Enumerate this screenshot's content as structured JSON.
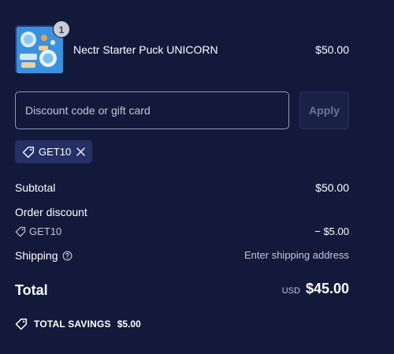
{
  "product": {
    "name": "Nectr Starter Puck UNICORN",
    "price": "$50.00",
    "quantity": "1",
    "thumbnail_icon": "product-image"
  },
  "discount": {
    "placeholder": "Discount code or gift card",
    "value": "",
    "apply_label": "Apply",
    "applied_code": "GET10"
  },
  "summary": {
    "subtotal_label": "Subtotal",
    "subtotal_value": "$50.00",
    "order_discount_label": "Order discount",
    "discount_code": "GET10",
    "discount_value": "− $5.00",
    "shipping_label": "Shipping",
    "shipping_value": "Enter shipping address",
    "total_label": "Total",
    "currency": "USD",
    "total_value": "$45.00",
    "savings_label": "TOTAL SAVINGS",
    "savings_value": "$5.00"
  },
  "colors": {
    "background": "#13193a",
    "chip": "#253066",
    "text_muted": "#c3c7d6"
  }
}
